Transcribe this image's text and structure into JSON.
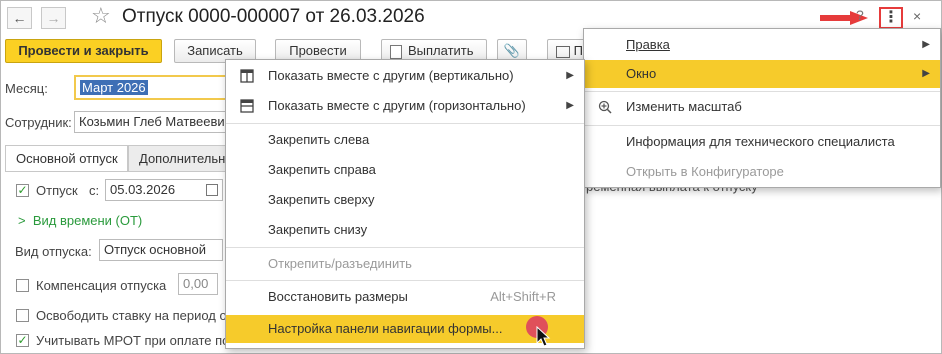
{
  "header": {
    "back_icon": "arrow-left-icon",
    "forward_icon": "arrow-right-icon",
    "favorite_icon": "star-icon",
    "title": "Отпуск 0000-000007 от 26.03.2026",
    "more_icon": "kebab-icon",
    "close_icon": "close-icon"
  },
  "toolbar": {
    "post_close_label": "Провести и закрыть",
    "save_label": "Записать",
    "post_label": "Провести",
    "pay_label": "Выплатить",
    "print_label": "П"
  },
  "form": {
    "month_label": "Месяц:",
    "month_value": "Март 2026",
    "employee_label": "Сотрудник:",
    "employee_value": "Козьмин Глеб Матвеевич",
    "tabs": [
      {
        "label": "Основной отпуск"
      },
      {
        "label": "Дополнительны"
      }
    ],
    "leave_checkbox_label": "Отпуск",
    "leave_from_label": "с:",
    "leave_from_value": "05.03.2026",
    "leave_checked": true,
    "time_kind_label": "Вид времени (ОТ)",
    "leave_kind_label": "Вид отпуска:",
    "leave_kind_value": "Отпуск основной",
    "compensation_label": "Компенсация отпуска",
    "compensation_value": "0,00",
    "release_rate_label": "Освободить ставку на период о",
    "mrot_label": "Учитывать МРОТ при оплате по",
    "mrot_checked": true,
    "background_text": "ременная выплата к отпуску"
  },
  "main_menu": {
    "items": [
      {
        "label": "Правка",
        "has_submenu": true
      },
      {
        "label": "Окно",
        "has_submenu": true,
        "highlighted": true
      },
      {
        "label": "Изменить масштаб",
        "icon": "zoom-icon"
      },
      {
        "label": "Информация для технического специалиста"
      },
      {
        "label": "Открыть в Конфигураторе",
        "disabled": true
      }
    ]
  },
  "window_submenu": {
    "items": [
      {
        "label": "Показать вместе с другим (вертикально)",
        "icon": "split-vertical-icon",
        "has_submenu": true
      },
      {
        "label": "Показать вместе с другим (горизонтально)",
        "icon": "split-horizontal-icon",
        "has_submenu": true
      },
      {
        "label": "Закрепить слева"
      },
      {
        "label": "Закрепить справа"
      },
      {
        "label": "Закрепить сверху"
      },
      {
        "label": "Закрепить снизу"
      },
      {
        "label": "Открепить/разъединить",
        "disabled": true
      },
      {
        "label": "Восстановить размеры",
        "shortcut": "Alt+Shift+R"
      },
      {
        "label": "Настройка панели навигации формы...",
        "highlighted": true
      }
    ]
  },
  "colors": {
    "accent_yellow": "#f6cb2b",
    "indicator_red": "#e63b3b",
    "selection_blue": "#3e6fb5",
    "link_green": "#2a9a3c"
  }
}
